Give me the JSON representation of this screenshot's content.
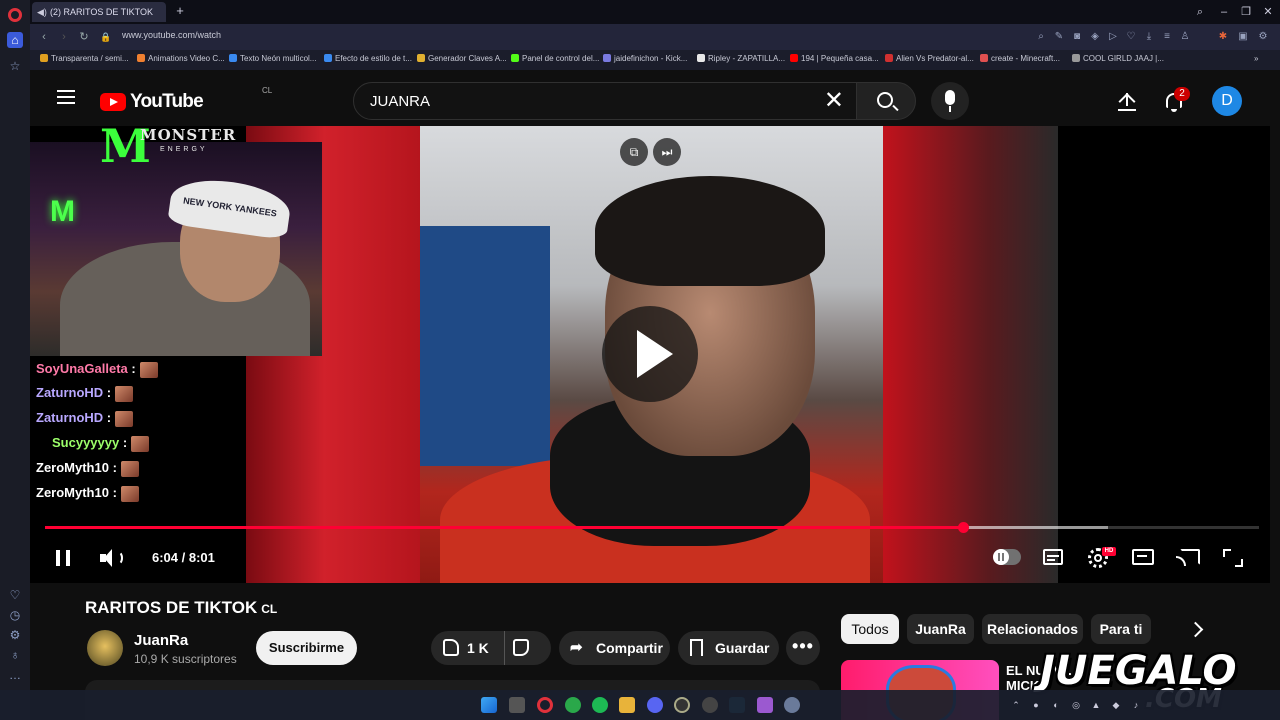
{
  "browser": {
    "tab_title": "(2) RARITOS DE TIKTOK",
    "url": "www.youtube.com/watch",
    "bookmarks": [
      {
        "label": "Transparenta / semi...",
        "color": "#e0a020"
      },
      {
        "label": "Animations Video C...",
        "color": "#f08030"
      },
      {
        "label": "Texto Neón multicol...",
        "color": "#3a8af0"
      },
      {
        "label": "Efecto de estilo de t...",
        "color": "#3a8af0"
      },
      {
        "label": "Generador Claves A...",
        "color": "#e0b030"
      },
      {
        "label": "Panel de control del...",
        "color": "#53fc18"
      },
      {
        "label": "jaidefinichon - Kick...",
        "color": "#7a7ae0"
      },
      {
        "label": "Ripley - ZAPATILLA...",
        "color": "#e8e8e8"
      },
      {
        "label": "194 | Pequeña casa...",
        "color": "#ff0000"
      },
      {
        "label": "Alien Vs Predator-al...",
        "color": "#d03030"
      },
      {
        "label": "create - Minecraft...",
        "color": "#e05050"
      },
      {
        "label": "COOL GIRLD JAAJ |...",
        "color": "#999999"
      }
    ]
  },
  "header": {
    "logo_text": "YouTube",
    "country_code": "CL",
    "search_value": "JUANRA",
    "notification_count": "2",
    "avatar_letter": "D"
  },
  "player": {
    "current_time": "6:04",
    "duration": "8:01",
    "time_display": "6:04 / 8:01",
    "progress_fraction": 0.756,
    "buffered_fraction": 0.876,
    "hd_badge": "HD"
  },
  "stream_overlay": {
    "sponsor_brand": "MONSTER",
    "sponsor_sub": "ENERGY",
    "cap_text": "NEW YORK YANKEES",
    "chat": [
      {
        "user": "SoyUnaGalleta",
        "color": "#ff7aa8"
      },
      {
        "user": "ZaturnoHD",
        "color": "#b9a8ff"
      },
      {
        "user": "ZaturnoHD",
        "color": "#b9a8ff"
      },
      {
        "user": "Sucyyyyyy",
        "color": "#9cff6a"
      },
      {
        "user": "ZeroMyth10",
        "color": "#ffffff"
      },
      {
        "user": "ZeroMyth10",
        "color": "#ffffff"
      }
    ]
  },
  "video": {
    "title": "RARITOS DE TIKTOK",
    "title_suffix": "CL",
    "channel_name": "JuanRa",
    "subscribers": "10,9 K suscriptores",
    "subscribe_label": "Suscribirme",
    "like_count": "1 K",
    "share_label": "Compartir",
    "save_label": "Guardar"
  },
  "chips": [
    "Todos",
    "JuanRa",
    "Relacionados",
    "Para ti"
  ],
  "related": {
    "title": "EL NUEV... MICK..."
  },
  "watermark": {
    "main": "JUEGALO",
    "domain": ".COM"
  },
  "colors": {
    "accent": "#ff0033",
    "yt_red": "#ff0000",
    "background": "#0f0f0f",
    "avatar": "#1e88e5"
  }
}
